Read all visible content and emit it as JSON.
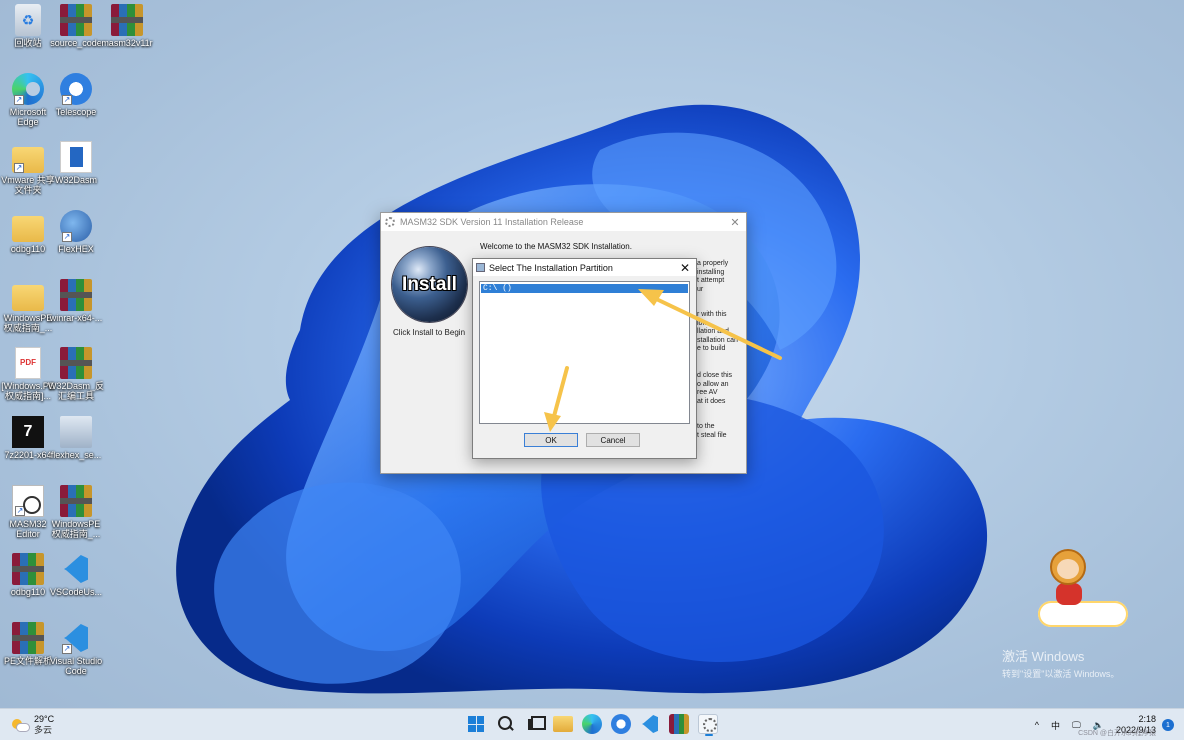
{
  "desktop": {
    "icons": [
      {
        "label": "回收站",
        "icon": "recycle-bin-icon"
      },
      {
        "label": "source_code",
        "icon": "winrar-archive-icon"
      },
      {
        "label": "masm32v11r",
        "icon": "winrar-archive-icon"
      },
      {
        "label": "Microsoft Edge",
        "icon": "edge-icon"
      },
      {
        "label": "Telescope",
        "icon": "telescope-icon"
      },
      {
        "label": "Vmware 共享文件夹",
        "icon": "folder-icon"
      },
      {
        "label": "W32Dasm",
        "icon": "w32dasm-icon"
      },
      {
        "label": "odbg110",
        "icon": "folder-icon"
      },
      {
        "label": "FlexHEX",
        "icon": "flexhex-icon"
      },
      {
        "label": "WindowsPE权威指南_...",
        "icon": "folder-icon"
      },
      {
        "label": "winrar-x64-...",
        "icon": "winrar-archive-icon"
      },
      {
        "label": "[Windows.PE权威指南]...",
        "icon": "pdf-icon"
      },
      {
        "label": "W32Dasm_反汇编工具",
        "icon": "winrar-archive-icon"
      },
      {
        "label": "7z2201-x64",
        "icon": "7zip-icon"
      },
      {
        "label": "flexhex_se...",
        "icon": "setup-icon"
      },
      {
        "label": "MASM32 Editor",
        "icon": "masm32-editor-icon"
      },
      {
        "label": "WindowsPE权威指南_...",
        "icon": "winrar-archive-icon"
      },
      {
        "label": "odbg110",
        "icon": "winrar-archive-icon"
      },
      {
        "label": "VSCodeUs...",
        "icon": "vscode-icon"
      },
      {
        "label": "PE文件解析",
        "icon": "winrar-archive-icon"
      },
      {
        "label": "Visual Studio Code",
        "icon": "vscode-icon"
      }
    ]
  },
  "installer": {
    "title": "MASM32 SDK Version 11 Installation Release",
    "logo_text": "Install",
    "click_hint": "Click Install to Begin",
    "welcome": "Welcome to the MASM32 SDK Installation.",
    "background_fragments": [
      "a properly\ninstalling\nt attempt\nur",
      "r with this\nion\nllation and\nstallation can\ne to build",
      "d close this\no allow an\nree AV\nat it does",
      "to the\nt steal file"
    ]
  },
  "dialog": {
    "title": "Select The Installation Partition",
    "partitions": [
      "C:\\ ()"
    ],
    "ok_label": "OK",
    "cancel_label": "Cancel"
  },
  "watermark": {
    "activate_title": "激活 Windows",
    "activate_sub": "转到\"设置\"以激活 Windows。"
  },
  "taskbar": {
    "weather_temp": "29°C",
    "weather_cond": "多云",
    "apps": [
      "start-icon",
      "search-icon",
      "task-view-icon",
      "file-explorer-icon",
      "edge-icon",
      "telescope-icon",
      "vscode-icon",
      "winrar-icon",
      "setup-icon"
    ],
    "tray": {
      "chevron": "^",
      "ime": "中",
      "time": "2:18",
      "date": "2022/9/13",
      "notification_count": "1"
    }
  },
  "footer_watermark": "CSDN @白开水的程序猿",
  "colors": {
    "selection": "#2f7fd6",
    "arrow": "#f6c34a"
  }
}
